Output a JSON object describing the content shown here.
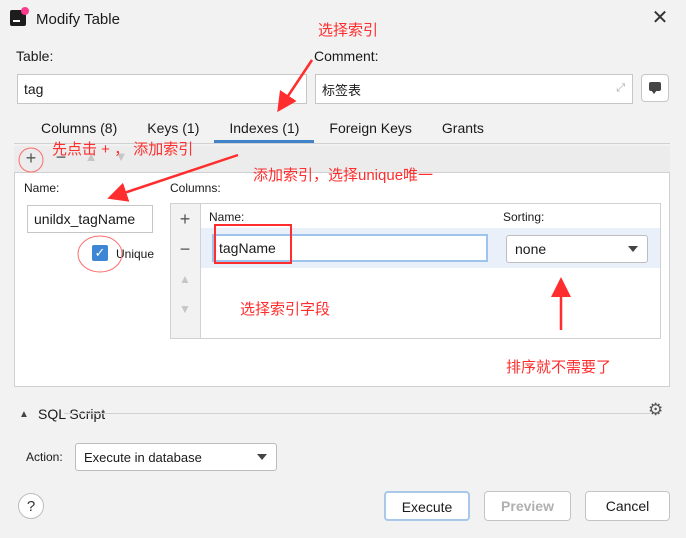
{
  "window": {
    "title": "Modify Table"
  },
  "form": {
    "table_label": "Table:",
    "table_value": "tag",
    "comment_label": "Comment:",
    "comment_value": "标签表"
  },
  "tabs": [
    {
      "label": "Columns (8)"
    },
    {
      "label": "Keys (1)"
    },
    {
      "label": "Indexes (1)"
    },
    {
      "label": "Foreign Keys"
    },
    {
      "label": "Grants"
    }
  ],
  "index": {
    "name_label": "Name:",
    "name_value": "unildx_tagName",
    "unique_label": "Unique",
    "columns_label": "Columns:",
    "col_header_name": "Name:",
    "col_header_sorting": "Sorting:",
    "column_name": "tagName",
    "sorting_value": "none"
  },
  "sql": {
    "label": "SQL Script",
    "action_label": "Action:",
    "action_value": "Execute in database"
  },
  "buttons": {
    "execute": "Execute",
    "preview": "Preview",
    "cancel": "Cancel",
    "help": "?"
  },
  "annotations": {
    "select_index": "选择索引",
    "click_add": "先点击 + ， 添加索引",
    "add_unique": "添加索引，选择unique唯一",
    "select_field": "选择索引字段",
    "no_sort": "排序就不需要了"
  },
  "colors": {
    "accent": "#4083c9",
    "annotation": "#ff2d2d"
  }
}
